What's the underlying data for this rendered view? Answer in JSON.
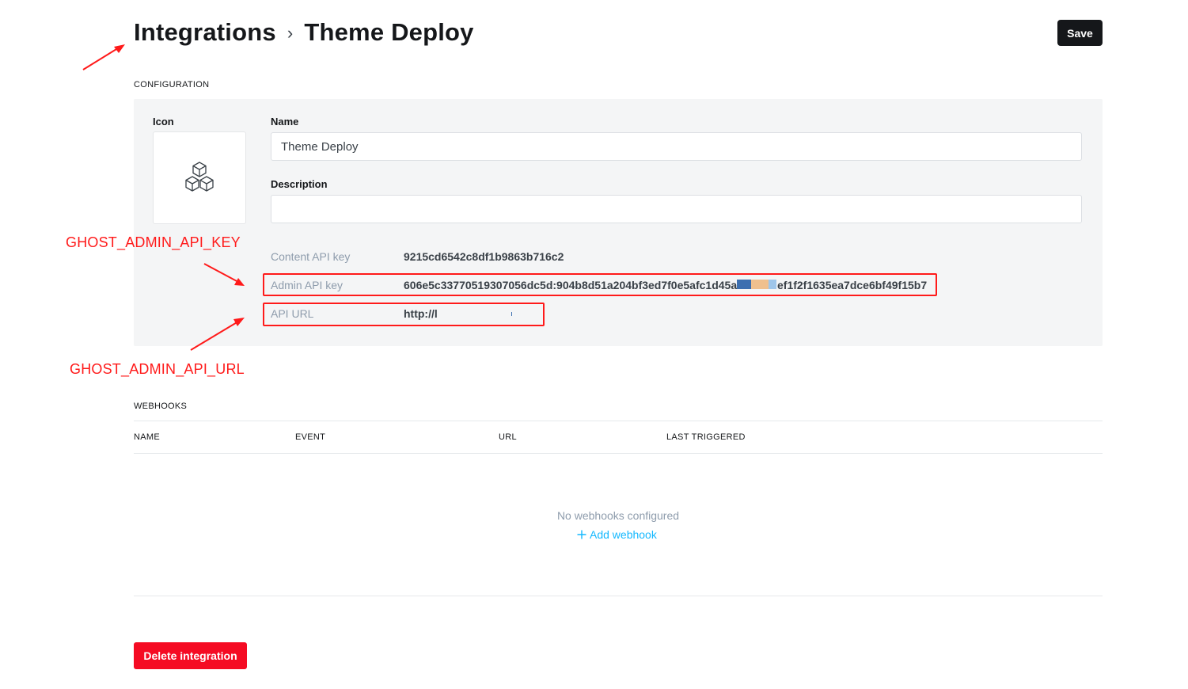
{
  "header": {
    "breadcrumb_parent": "Integrations",
    "breadcrumb_separator": "›",
    "breadcrumb_current": "Theme Deploy",
    "save_label": "Save"
  },
  "configuration": {
    "section_title": "CONFIGURATION",
    "icon_label": "Icon",
    "icon_name": "boxes-icon",
    "name_label": "Name",
    "name_value": "Theme Deploy",
    "description_label": "Description",
    "description_value": "",
    "content_api_key_label": "Content API key",
    "content_api_key_value": "9215cd6542c8df1b9863b716c2",
    "admin_api_key_label": "Admin API key",
    "admin_api_key_value_start": "606e5c33770519307056dc5d:904b8d51a204bf3ed7f0e5afc1d45a1",
    "admin_api_key_value_end": "ef1f2f1635ea7dce6bf49f15b7",
    "api_url_label": "API URL",
    "api_url_value": "http://l"
  },
  "annotations": {
    "admin_key_note": "GHOST_ADMIN_API_KEY",
    "api_url_note": "GHOST_ADMIN_API_URL",
    "color": "#ff1a1a"
  },
  "webhooks": {
    "section_title": "WEBHOOKS",
    "columns": [
      "NAME",
      "EVENT",
      "URL",
      "LAST TRIGGERED"
    ],
    "empty_text": "No webhooks configured",
    "add_label": "Add webhook",
    "add_icon": "plus-icon"
  },
  "footer": {
    "delete_label": "Delete integration"
  },
  "colors": {
    "primary_dark": "#15171a",
    "danger": "#f50b23",
    "link": "#14b8ff",
    "panel_bg": "#f4f5f6"
  }
}
